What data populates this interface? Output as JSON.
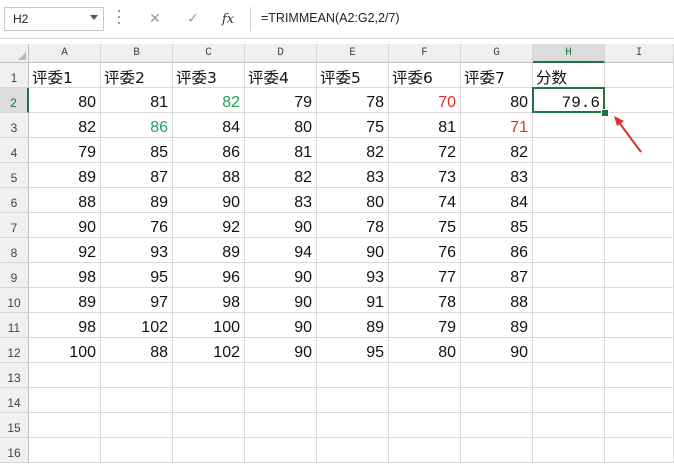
{
  "formula_bar": {
    "name_box": "H2",
    "cancel_icon": "✕",
    "enter_icon": "✓",
    "fx_label": "fx",
    "formula": "=TRIMMEAN(A2:G2,2/7)"
  },
  "columns": [
    "A",
    "B",
    "C",
    "D",
    "E",
    "F",
    "G",
    "H",
    "I"
  ],
  "rows": [
    "1",
    "2",
    "3",
    "4",
    "5",
    "6",
    "7",
    "8",
    "9",
    "10",
    "11",
    "12",
    "13",
    "14",
    "15",
    "16"
  ],
  "headers": [
    "评委1",
    "评委2",
    "评委3",
    "评委4",
    "评委5",
    "评委6",
    "评委7",
    "分数"
  ],
  "data": [
    [
      "80",
      "81",
      "82",
      "79",
      "78",
      "70",
      "80"
    ],
    [
      "82",
      "86",
      "84",
      "80",
      "75",
      "81",
      "71"
    ],
    [
      "79",
      "85",
      "86",
      "81",
      "82",
      "72",
      "82"
    ],
    [
      "89",
      "87",
      "88",
      "82",
      "83",
      "73",
      "83"
    ],
    [
      "88",
      "89",
      "90",
      "83",
      "80",
      "74",
      "84"
    ],
    [
      "90",
      "76",
      "92",
      "90",
      "78",
      "75",
      "85"
    ],
    [
      "92",
      "93",
      "89",
      "94",
      "90",
      "76",
      "86"
    ],
    [
      "98",
      "95",
      "96",
      "90",
      "93",
      "77",
      "87"
    ],
    [
      "89",
      "97",
      "98",
      "90",
      "91",
      "78",
      "88"
    ],
    [
      "98",
      "102",
      "100",
      "90",
      "89",
      "79",
      "89"
    ],
    [
      "100",
      "88",
      "102",
      "90",
      "95",
      "80",
      "90"
    ]
  ],
  "highlights": {
    "green": [
      [
        0,
        2
      ],
      [
        1,
        1
      ]
    ],
    "red": [
      [
        0,
        5
      ],
      [
        1,
        6
      ]
    ]
  },
  "result": "79.6",
  "colors": {
    "accent": "#217346",
    "green_text": "#22a05a",
    "red_text": "#e0302a",
    "arrow": "#e0302a"
  },
  "annotation": {
    "icon": "red-arrow-icon"
  }
}
